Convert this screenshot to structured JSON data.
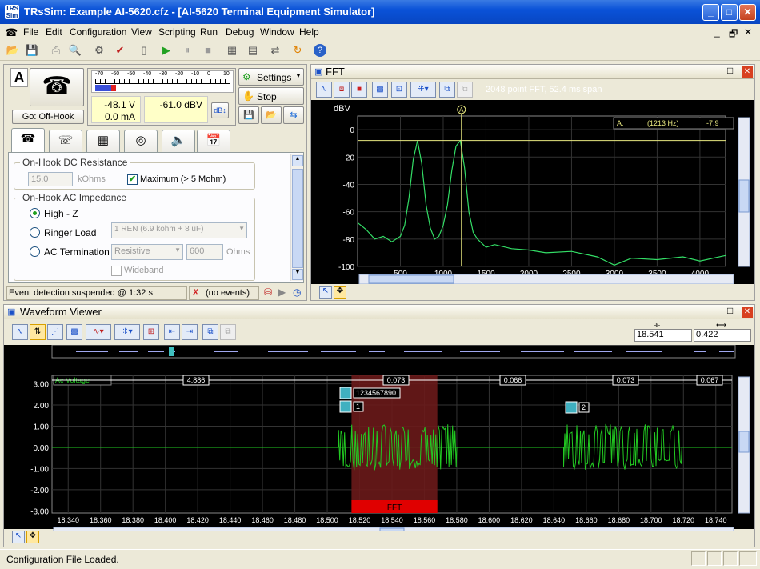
{
  "window": {
    "title": "TRsSim:  Example AI-5620.cfz - [AI-5620  Terminal Equipment Simulator]",
    "app_icon_text": "TRS Sim",
    "min": "_",
    "max": "□",
    "close": "✕"
  },
  "menu": [
    "File",
    "Edit",
    "Configuration",
    "View",
    "Scripting",
    "Run",
    "Debug",
    "Window",
    "Help"
  ],
  "mdi_buttons": [
    "_",
    "🗗",
    "✕"
  ],
  "left_panel": {
    "channel_letter": "A",
    "go_button": "Go:  Off-Hook",
    "meter_scale": [
      "-70",
      "-60",
      "-50",
      "-40",
      "-30",
      "-20",
      "-10",
      "0",
      "10"
    ],
    "voltage": "-48.1  V",
    "current": "0.0 mA",
    "level": "-61.0 dBV",
    "settings_label": "Settings",
    "stop_label": "Stop",
    "group_dc": "On-Hook DC Resistance",
    "dc_value": "15.0",
    "dc_unit": "kOhms",
    "dc_max_label": "Maximum (> 5 Mohm)",
    "group_ac": "On-Hook AC Impedance",
    "radio_high": "High - Z",
    "radio_ringer": "Ringer Load",
    "ringer_select": "1 REN (6.9 kohm + 8 uF)",
    "radio_ac_term": "AC Termination",
    "term_select": "Resistive",
    "term_value": "600",
    "term_unit": "Ohms",
    "wideband": "Wideband",
    "status_left": "Event detection suspended @ 1:32 s",
    "status_events": "(no events)"
  },
  "fft": {
    "title": "FFT",
    "info": "2048 point FFT, 52.4 ms span",
    "y_unit": "dBV",
    "marker_label": "A:",
    "marker_freq": "(1213 Hz)",
    "marker_val": "-7.9",
    "marker_tag": "A",
    "y_ticks": [
      "0",
      "-20",
      "-40",
      "-60",
      "-80",
      "-100"
    ],
    "x_ticks": [
      "500",
      "1000",
      "1500",
      "2000",
      "2500",
      "3000",
      "3500",
      "4000"
    ]
  },
  "waveform": {
    "title": "Waveform Viewer",
    "time_value": "18.541",
    "span_value": "0.422",
    "trace_label": "Ac Voltage",
    "intervals": [
      "4.886",
      "0.073",
      "0.066",
      "0.073",
      "0.067"
    ],
    "tag_digits": "1234567890",
    "tag1": "1",
    "tag2": "2",
    "fft_label": "FFT",
    "y_ticks": [
      "3.00",
      "2.00",
      "1.00",
      "0.00",
      "-1.00",
      "-2.00",
      "-3.00"
    ],
    "x_ticks": [
      "18.340",
      "18.360",
      "18.380",
      "18.400",
      "18.420",
      "18.440",
      "18.460",
      "18.480",
      "18.500",
      "18.520",
      "18.540",
      "18.560",
      "18.580",
      "18.600",
      "18.620",
      "18.640",
      "18.660",
      "18.680",
      "18.700",
      "18.720",
      "18.740"
    ]
  },
  "statusbar": {
    "text": "Configuration File Loaded."
  },
  "chart_data": [
    {
      "type": "line",
      "title": "FFT",
      "ylabel": "dBV",
      "xlim": [
        0,
        4300
      ],
      "ylim": [
        -100,
        10
      ],
      "x": [
        0,
        100,
        200,
        300,
        400,
        500,
        550,
        600,
        650,
        700,
        750,
        800,
        850,
        900,
        950,
        1000,
        1050,
        1100,
        1150,
        1200,
        1250,
        1300,
        1350,
        1400,
        1500,
        1600,
        1800,
        2000,
        2200,
        2500,
        2800,
        3000,
        3200,
        3500,
        3800,
        4000,
        4300
      ],
      "series": [
        {
          "values": [
            -68,
            -73,
            -80,
            -78,
            -82,
            -78,
            -70,
            -50,
            -22,
            -8,
            -25,
            -55,
            -72,
            -80,
            -78,
            -70,
            -55,
            -30,
            -12,
            -8,
            -28,
            -60,
            -75,
            -80,
            -86,
            -84,
            -87,
            -88,
            -90,
            -89,
            -93,
            -99,
            -94,
            -95,
            -93,
            -96,
            -92
          ]
        }
      ],
      "marker": {
        "x": 1213,
        "y": -7.9
      },
      "color": "#33dd66"
    },
    {
      "type": "line",
      "title": "Waveform Viewer",
      "ylabel": "Ac Voltage",
      "xlim": [
        18.33,
        18.75
      ],
      "ylim": [
        -3.1,
        3.4
      ],
      "bursts": [
        {
          "start": 18.507,
          "end": 18.58,
          "amplitude": 1.1
        },
        {
          "start": 18.646,
          "end": 18.719,
          "amplitude": 1.1
        }
      ],
      "fft_window": [
        18.515,
        18.568
      ],
      "color": "#22c922"
    }
  ]
}
